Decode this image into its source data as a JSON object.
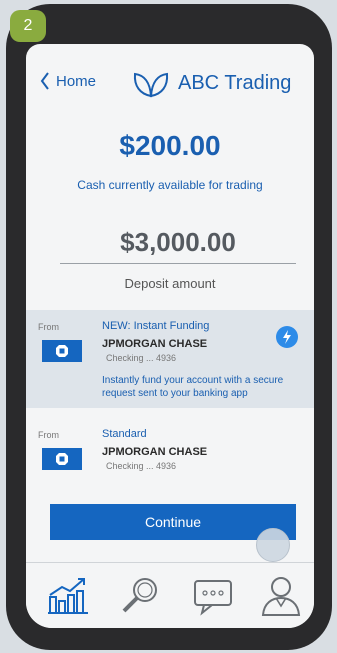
{
  "step_badge": "2",
  "header": {
    "back_label": "Home",
    "brand": "ABC Trading"
  },
  "cash": {
    "amount": "$200.00",
    "caption": "Cash currently available for trading"
  },
  "deposit": {
    "value": "$3,000.00",
    "label": "Deposit amount"
  },
  "options": [
    {
      "from": "From",
      "title": "NEW: Instant Funding",
      "bank": "JPMORGAN CHASE",
      "account": "Checking ... 4936",
      "description": "Instantly fund your account with a secure request sent to your banking app",
      "icon": "lightning-bolt-icon"
    },
    {
      "from": "From",
      "title": "Standard",
      "bank": "JPMORGAN CHASE",
      "account": "Checking ... 4936"
    }
  ],
  "continue_label": "Continue",
  "tabs": [
    "chart-icon",
    "search-icon",
    "chat-icon",
    "profile-icon"
  ],
  "colors": {
    "accent": "#1566c0",
    "text_blue": "#1a5fb0",
    "badge": "#8aab3f"
  }
}
